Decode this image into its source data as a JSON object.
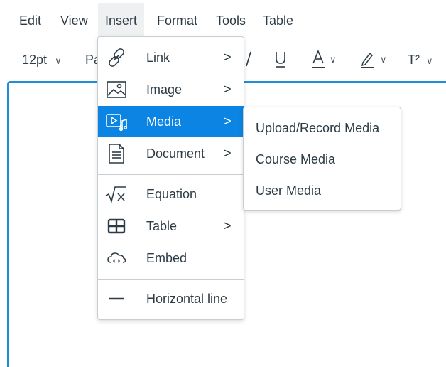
{
  "menubar": {
    "items": [
      "Edit",
      "View",
      "Insert",
      "Format",
      "Tools",
      "Table"
    ],
    "active": "Insert"
  },
  "toolbar": {
    "font_size": "12pt",
    "paragraph_partial": "Pa",
    "italic_icon": "italic-icon",
    "underline_icon": "underline-icon",
    "text_color_icon": "text-color-icon",
    "highlight_icon": "highlight-icon",
    "superscript_label": "T²",
    "chevron": "∨"
  },
  "insert_menu": {
    "items": [
      {
        "label": "Link",
        "icon": "link-icon",
        "has_submenu": true
      },
      {
        "label": "Image",
        "icon": "image-icon",
        "has_submenu": true
      },
      {
        "label": "Media",
        "icon": "media-icon",
        "has_submenu": true,
        "selected": true
      },
      {
        "label": "Document",
        "icon": "document-icon",
        "has_submenu": true
      },
      {
        "label": "Equation",
        "icon": "equation-icon",
        "has_submenu": false
      },
      {
        "label": "Table",
        "icon": "table-icon",
        "has_submenu": true
      },
      {
        "label": "Embed",
        "icon": "embed-icon",
        "has_submenu": false
      },
      {
        "label": "Horizontal line",
        "icon": "horizontal-line-icon",
        "has_submenu": false
      }
    ],
    "arrow": ">"
  },
  "media_submenu": {
    "items": [
      "Upload/Record Media",
      "Course Media",
      "User Media"
    ]
  },
  "colors": {
    "accent": "#0b84e3",
    "editor_border": "#1f8fd6",
    "text": "#2d3b45",
    "menu_border": "#c7cdd1"
  }
}
